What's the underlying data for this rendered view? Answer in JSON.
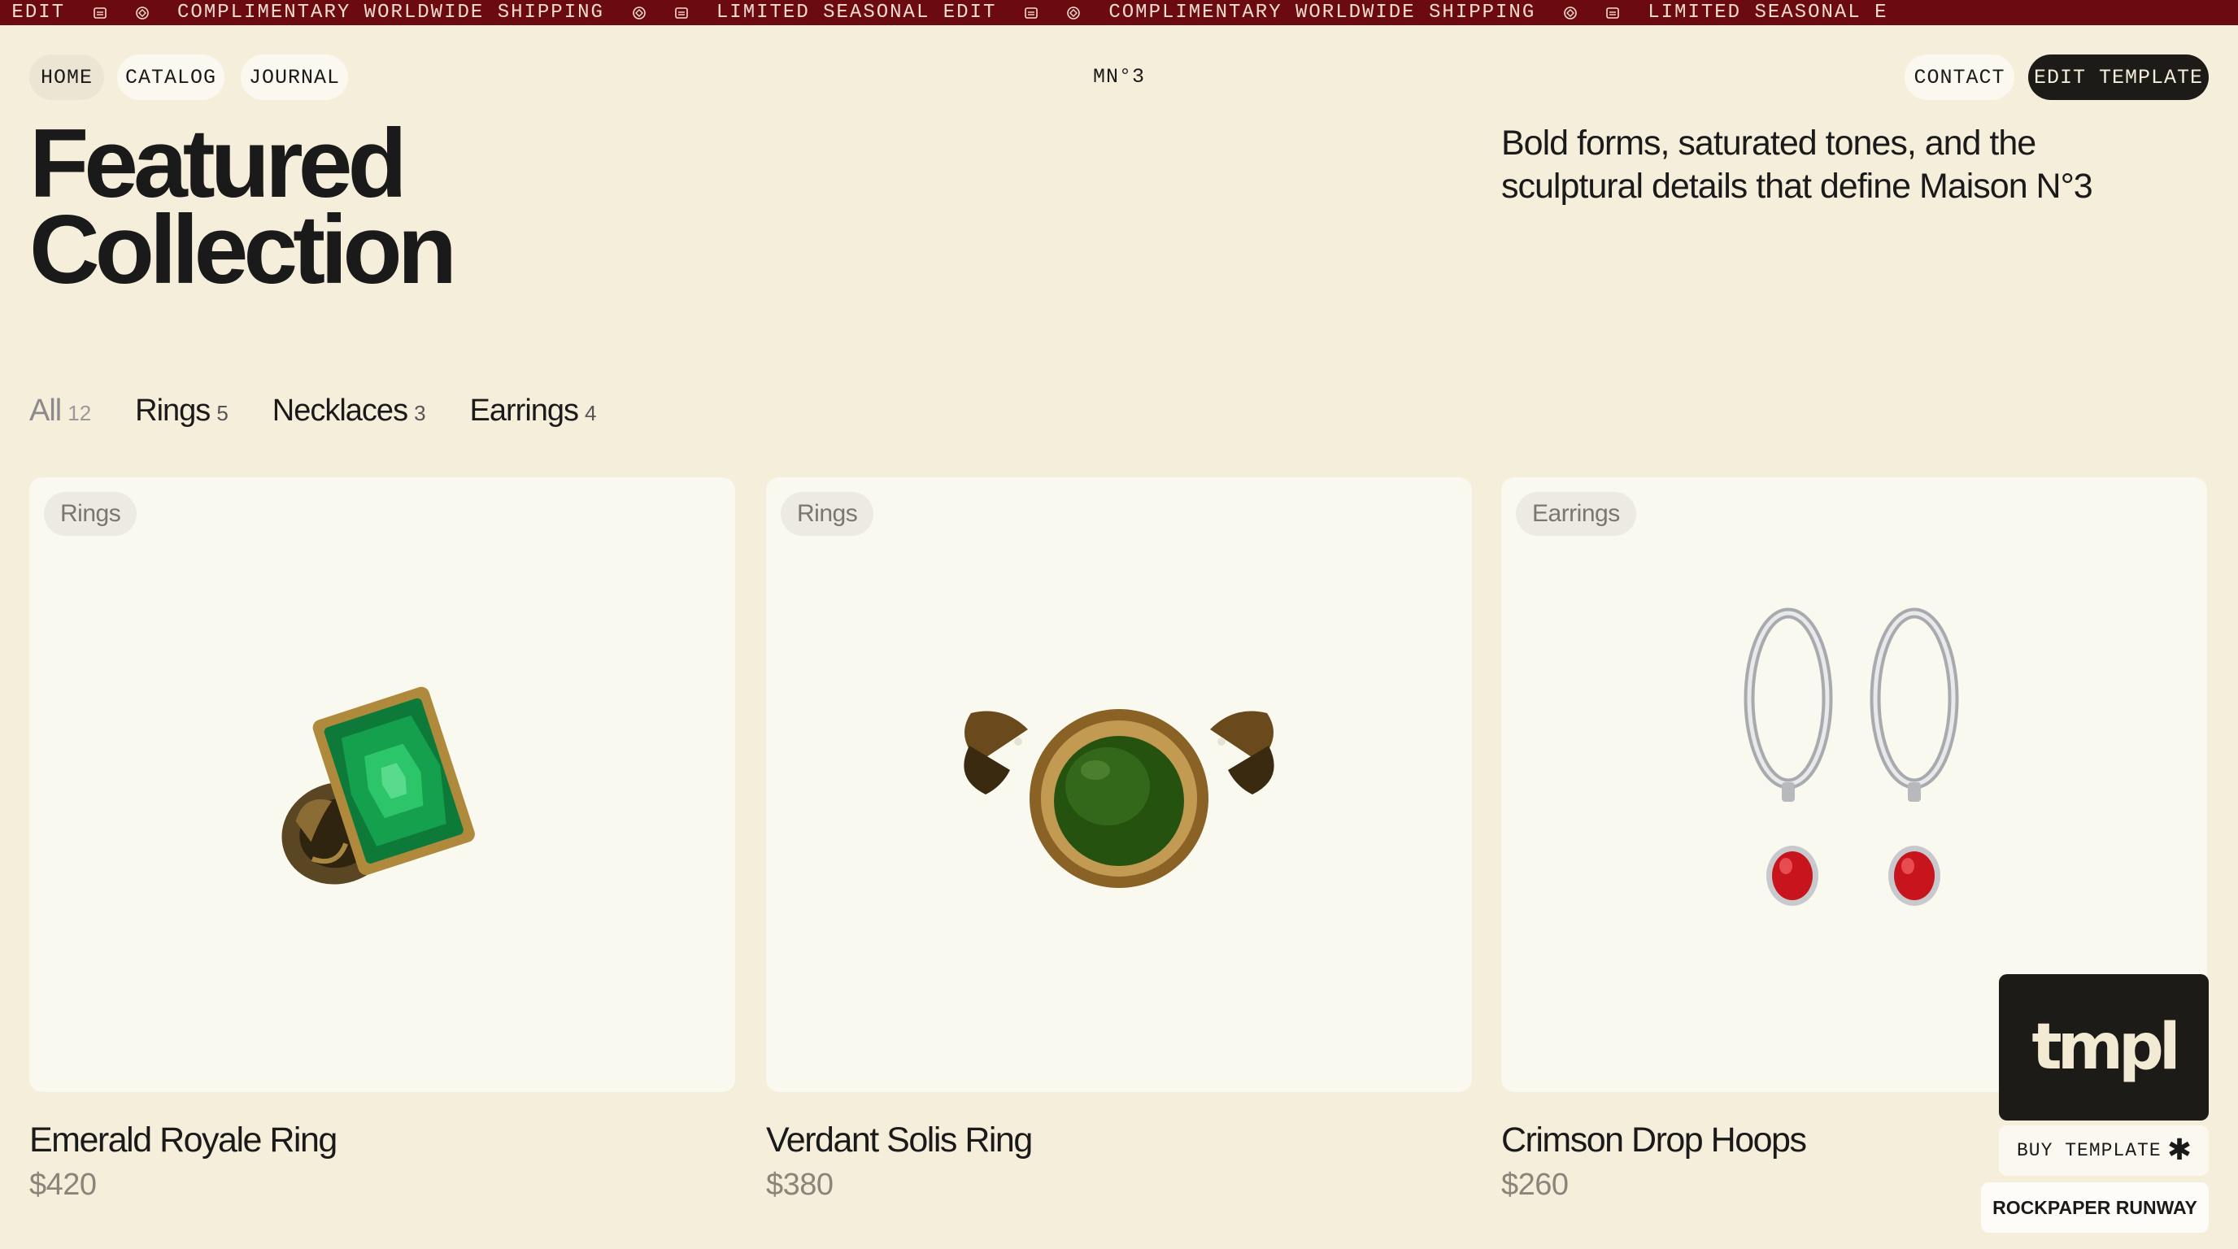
{
  "ticker": {
    "items": [
      {
        "text": "SONAL EDIT",
        "icon": "box-icon"
      },
      {
        "text": "COMPLIMENTARY WORLDWIDE SHIPPING",
        "icon": "globe-icon"
      },
      {
        "text": "LIMITED SEASONAL EDIT",
        "icon": "box-icon"
      },
      {
        "text": "COMPLIMENTARY WORLDWIDE SHIPPING",
        "icon": "globe-icon"
      },
      {
        "text": "LIMITED SEASONAL E",
        "icon": "box-icon"
      }
    ],
    "background": "#6b0b10"
  },
  "nav": {
    "home": "HOME",
    "catalog": "CATALOG",
    "journal": "JOURNAL",
    "logo": "MN°3",
    "contact": "CONTACT",
    "edit_template": "EDIT TEMPLATE"
  },
  "hero": {
    "title_line1": "Featured",
    "title_line2": "Collection",
    "description": "Bold forms, saturated tones, and the sculptural details that define Maison N°3"
  },
  "filters": [
    {
      "label": "All",
      "count": "12",
      "active": true
    },
    {
      "label": "Rings",
      "count": "5",
      "active": false
    },
    {
      "label": "Necklaces",
      "count": "3",
      "active": false
    },
    {
      "label": "Earrings",
      "count": "4",
      "active": false
    }
  ],
  "products": [
    {
      "tag": "Rings",
      "name": "Emerald Royale Ring",
      "price": "$420",
      "image": "emerald-ring-image"
    },
    {
      "tag": "Rings",
      "name": "Verdant Solis Ring",
      "price": "$380",
      "image": "jade-ring-image"
    },
    {
      "tag": "Earrings",
      "name": "Crimson Drop Hoops",
      "price": "$260",
      "image": "crimson-hoops-image"
    }
  ],
  "promo": {
    "badge_logo": "tmpl",
    "buy_label": "BUY TEMPLATE",
    "buy_icon": "✱",
    "brand": "ROCKPAPER RUNWAY"
  },
  "colors": {
    "background": "#f5eedb",
    "card": "#f9f9f0",
    "dark": "#1d1b18",
    "accent": "#6b0b10"
  }
}
